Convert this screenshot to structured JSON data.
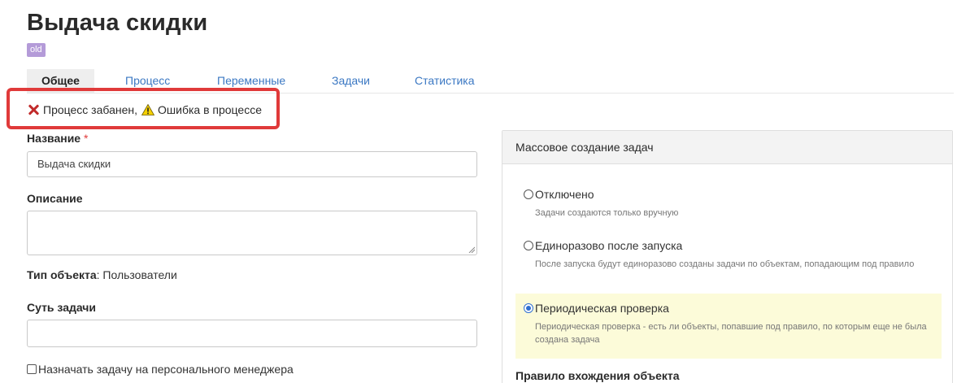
{
  "page": {
    "title": "Выдача скидки",
    "badge": "old"
  },
  "tabs": [
    {
      "label": "Общее",
      "active": true
    },
    {
      "label": "Процесс",
      "active": false
    },
    {
      "label": "Переменные",
      "active": false
    },
    {
      "label": "Задачи",
      "active": false
    },
    {
      "label": "Статистика",
      "active": false
    }
  ],
  "status": {
    "banned_text": "Процесс забанен,",
    "error_text": "Ошибка в процессе",
    "banned_icon": "x-icon",
    "error_icon": "warning-icon",
    "highlight_color": "#e03a3a"
  },
  "form": {
    "name_label": "Название",
    "name_required_mark": "*",
    "name_value": "Выдача скидки",
    "description_label": "Описание",
    "description_value": "",
    "object_type_label": "Тип объекта",
    "object_type_value": ": Пользователи",
    "task_essence_label": "Суть задачи",
    "task_essence_value": "",
    "assign_manager_label": "Назначать задачу на персонального менеджера",
    "assign_manager_checked": false
  },
  "mass_creation": {
    "title": "Массовое создание задач",
    "options": [
      {
        "label": "Отключено",
        "description": "Задачи создаются только вручную",
        "checked": false
      },
      {
        "label": "Единоразово после запуска",
        "description": "После запуска будут единоразово созданы задачи по объектам, попадающим под правило",
        "checked": false
      },
      {
        "label": "Периодическая проверка",
        "description": "Периодическая проверка - есть ли объекты, попавшие под правило, по которым еще не была создана задача",
        "checked": true
      }
    ],
    "rule_title": "Правило вхождения объекта"
  },
  "colors": {
    "link": "#3b78c3",
    "badge": "#b49bd8",
    "selected_option_bg": "#fcfbd9",
    "radio_accent": "#2f6fd0"
  }
}
